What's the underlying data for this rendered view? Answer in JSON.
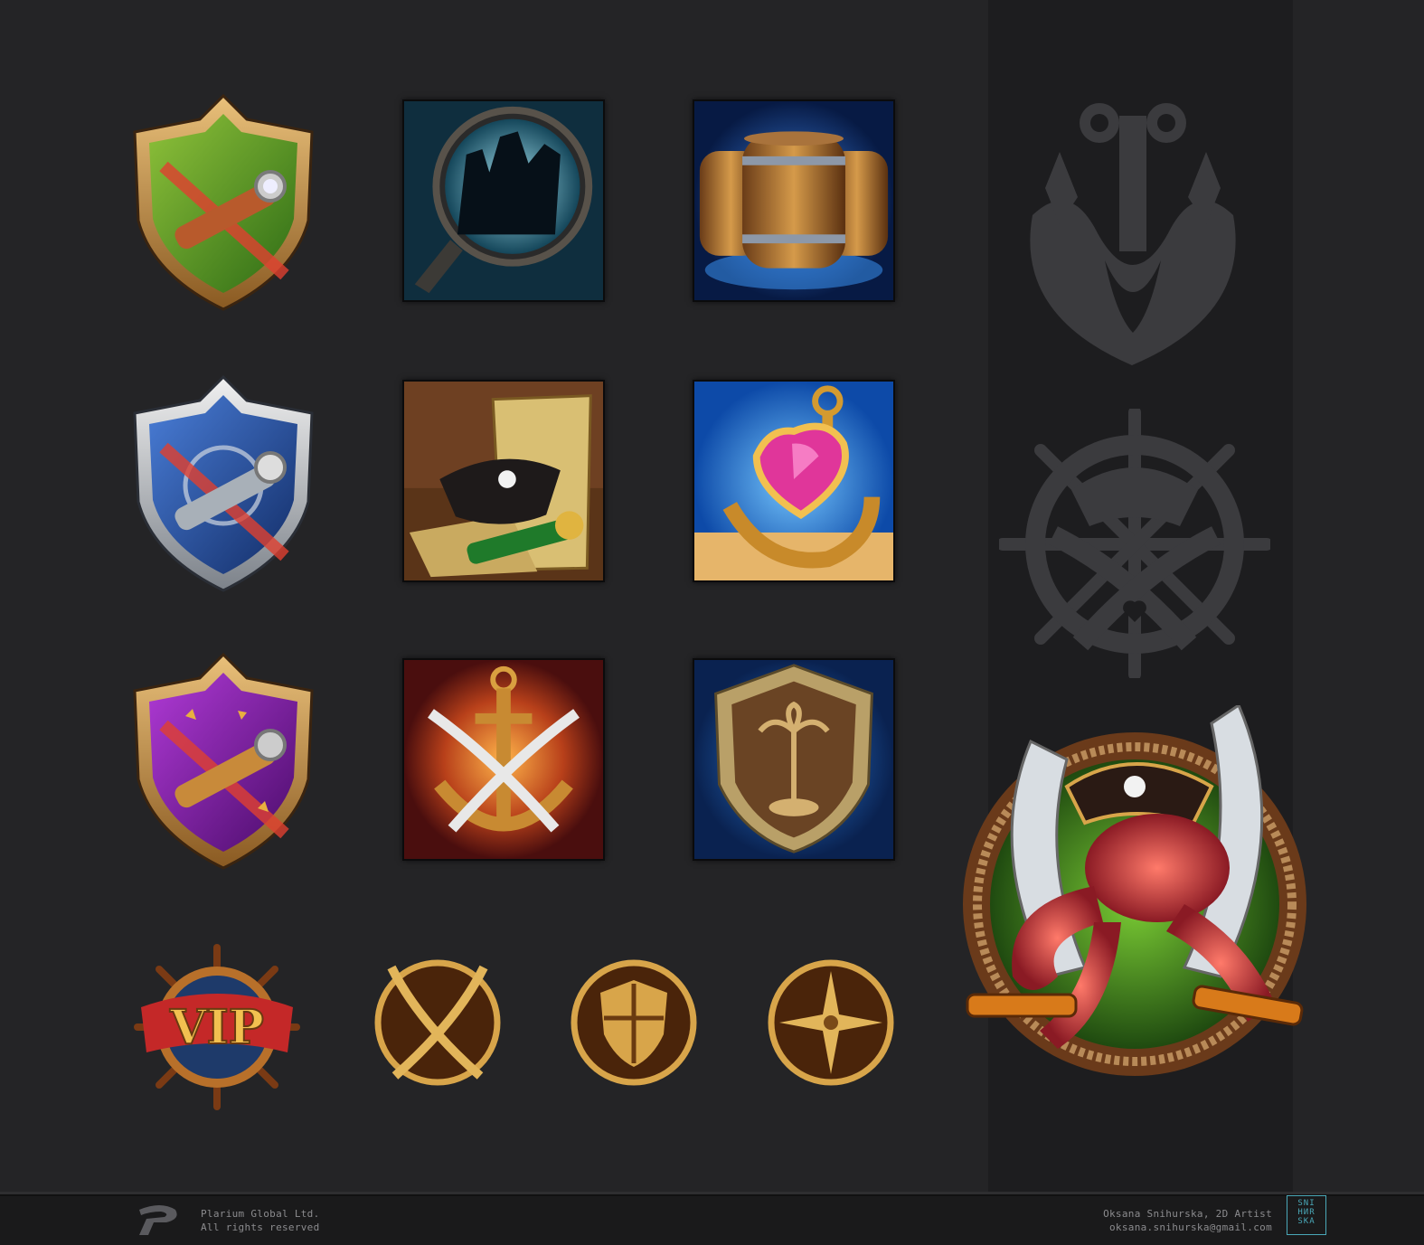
{
  "footer": {
    "company_line1": "Plarium Global Ltd.",
    "company_line2": "All rights reserved",
    "artist_line1": "Oksana Snihurska, 2D Artist",
    "artist_line2": "oksana.snihurska@gmail.com",
    "signature_logo": [
      "SNI",
      "HИR",
      "SKA"
    ]
  },
  "icons": {
    "vip_label": "VIP"
  },
  "colors": {
    "background": "#242426",
    "side_panel": "#1d1d1f",
    "gold": "#d8a54a",
    "signature_accent": "#4aa8b8"
  }
}
